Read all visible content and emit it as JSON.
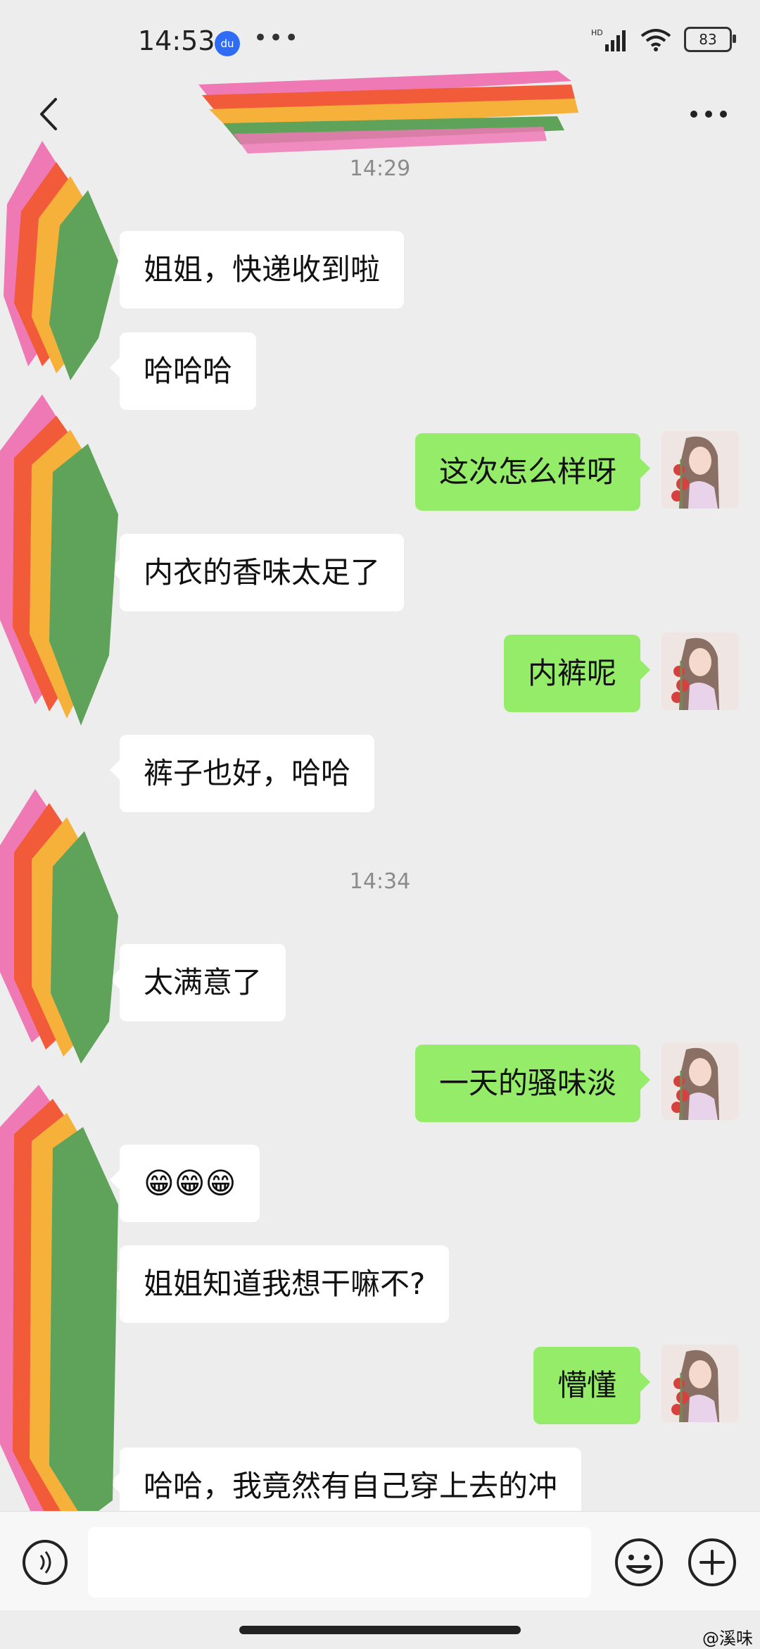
{
  "status_bar": {
    "time": "14:53",
    "app_icon": "baidu-icon",
    "app_icon_text": "du",
    "more": "•••",
    "network_label": "HD",
    "battery": "83"
  },
  "nav": {
    "back_icon": "back-arrow-icon",
    "more_icon": "more-dots-icon"
  },
  "chat": {
    "timestamps": [
      "14:29",
      "14:34"
    ],
    "messages": [
      {
        "side": "left",
        "text": "姐姐，快递收到啦"
      },
      {
        "side": "left",
        "text": "哈哈哈"
      },
      {
        "side": "right",
        "text": "这次怎么样呀"
      },
      {
        "side": "left",
        "text": "内衣的香味太足了"
      },
      {
        "side": "right",
        "text": "内裤呢"
      },
      {
        "side": "left",
        "text": "裤子也好，哈哈"
      },
      {
        "side": "left",
        "text": "太满意了"
      },
      {
        "side": "right",
        "text": "一天的骚味淡"
      },
      {
        "side": "left",
        "text": "😁😁😁"
      },
      {
        "side": "left",
        "text": "姐姐知道我想干嘛不?"
      },
      {
        "side": "right",
        "text": "懵懂"
      },
      {
        "side": "left",
        "text": "哈哈，我竟然有自己穿上去的冲"
      }
    ]
  },
  "input_bar": {
    "voice_icon": "voice-icon",
    "emoji_icon": "emoji-icon",
    "plus_icon": "plus-icon"
  },
  "watermark": "@溪味",
  "colors": {
    "background": "#ededed",
    "bubble_in": "#ffffff",
    "bubble_out": "#95ec69",
    "redaction": [
      "#ef79b5",
      "#f25b3a",
      "#f6b13a",
      "#5fa25a"
    ]
  }
}
